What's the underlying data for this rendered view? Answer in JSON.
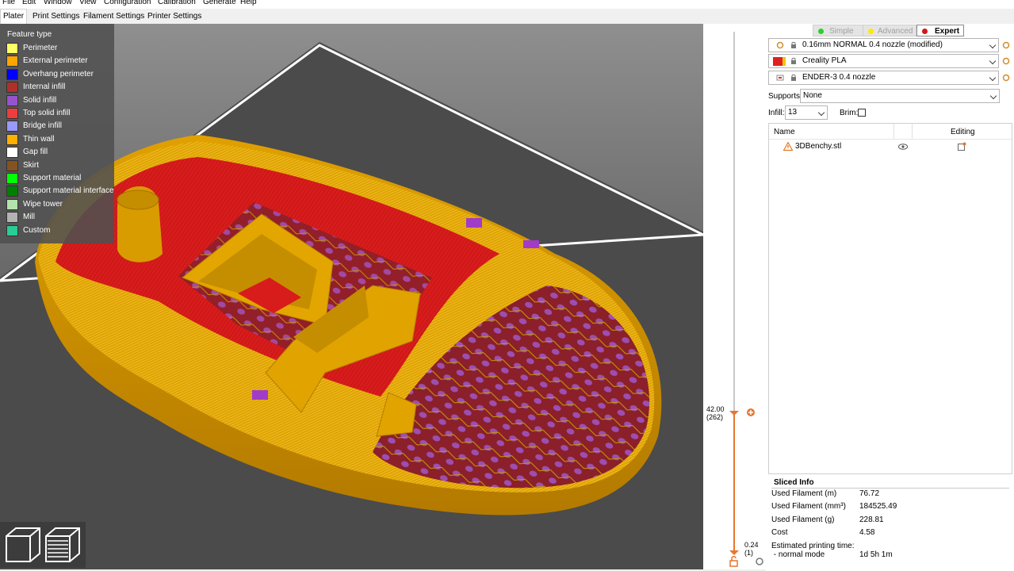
{
  "menu": [
    "File",
    "Edit",
    "Window",
    "View",
    "Configuration",
    "Calibration",
    "Generate",
    "Help"
  ],
  "tabs": [
    "Plater",
    "Print Settings",
    "Filament Settings",
    "Printer Settings"
  ],
  "legend": {
    "title": "Feature type",
    "items": [
      {
        "label": "Perimeter",
        "color": "#ffff66"
      },
      {
        "label": "External perimeter",
        "color": "#ffa500"
      },
      {
        "label": "Overhang perimeter",
        "color": "#0000ff"
      },
      {
        "label": "Internal infill",
        "color": "#b03029"
      },
      {
        "label": "Solid infill",
        "color": "#9654cc"
      },
      {
        "label": "Top solid infill",
        "color": "#f03c3c"
      },
      {
        "label": "Bridge infill",
        "color": "#9999ff"
      },
      {
        "label": "Thin wall",
        "color": "#ffb000"
      },
      {
        "label": "Gap fill",
        "color": "#ffffff"
      },
      {
        "label": "Skirt",
        "color": "#845321"
      },
      {
        "label": "Support material",
        "color": "#00ff00"
      },
      {
        "label": "Support material interface",
        "color": "#008000"
      },
      {
        "label": "Wipe tower",
        "color": "#b3e3ab"
      },
      {
        "label": "Mill",
        "color": "#b3b3b3"
      },
      {
        "label": "Custom",
        "color": "#28cc94"
      }
    ]
  },
  "slider": {
    "top_value": "42.00",
    "top_layer": "(262)",
    "bottom_value": "0.24",
    "bottom_layer": "(1)",
    "accent": "#e8772e"
  },
  "modes": {
    "simple": {
      "label": "Simple",
      "color": "#2cd12c"
    },
    "advanced": {
      "label": "Advanced",
      "color": "#ffea00"
    },
    "expert": {
      "label": "Expert",
      "color": "#d11717"
    }
  },
  "presets": {
    "print": "0.16mm NORMAL 0.4 nozzle (modified)",
    "filament": "Creality PLA",
    "printer": "ENDER-3 0.4 nozzle"
  },
  "options": {
    "supports_label": "Supports:",
    "supports_value": "None",
    "infill_label": "Infill:",
    "infill_value": "13",
    "brim_label": "Brim:",
    "brim_checked": false
  },
  "object_list": {
    "col_name": "Name",
    "col_editing": "Editing",
    "items": [
      {
        "name": "3DBenchy.stl",
        "warning": true
      }
    ]
  },
  "sliced_info": {
    "title": "Sliced Info",
    "rows": [
      {
        "label": "Used Filament (m)",
        "value": "76.72"
      },
      {
        "label": "Used Filament (mm³)",
        "value": "184525.49"
      },
      {
        "label": "Used Filament (g)",
        "value": "228.81"
      },
      {
        "label": "Cost",
        "value": "4.58"
      },
      {
        "label": "Estimated printing time:",
        "value": ""
      },
      {
        "label": " - normal mode",
        "value": "1d 5h 1m"
      }
    ]
  }
}
